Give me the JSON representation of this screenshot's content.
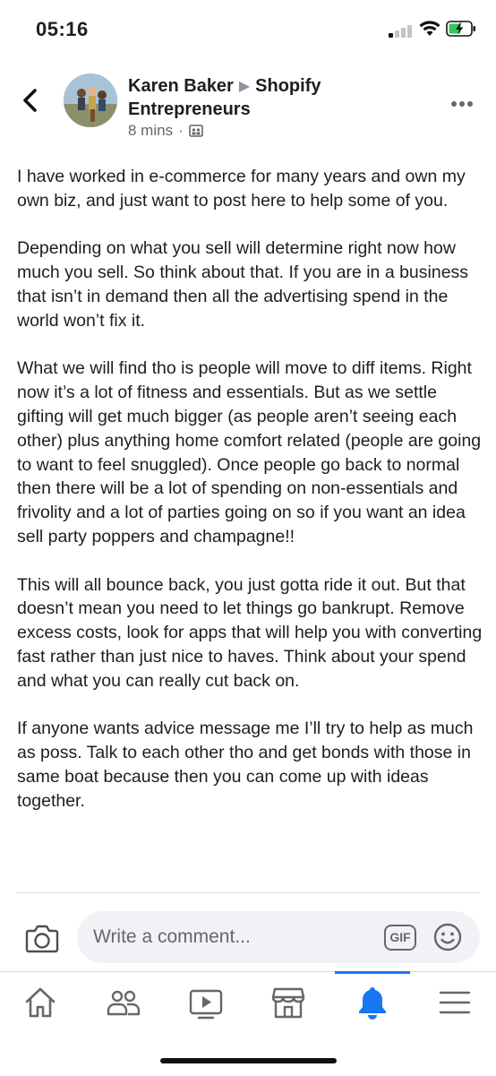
{
  "status_bar": {
    "time": "05:16"
  },
  "post": {
    "author": "Karen Baker",
    "group": "Shopify Entrepreneurs",
    "time_ago": "8 mins",
    "paragraphs": [
      "I have worked in e-commerce for many years and own my own biz, and just want to post here to help some of you.",
      "Depending on what you sell will determine right now how much you sell. So think about that. If you are in a business that isn’t in demand then all the advertising spend in the world won’t fix it.",
      "What we will find tho is people will move to diff items. Right now it’s a lot of fitness and essentials. But as we settle gifting will get much bigger (as people aren’t seeing each other) plus anything home comfort related (people are going to want to feel snuggled). Once people go back to normal then there will be a lot of spending on non-essentials and frivolity and a lot of parties going on so if you want an idea sell party poppers and champagne!!",
      "This will all bounce back, you just gotta ride it out. But that doesn’t mean you need to let things go bankrupt. Remove excess costs, look for apps that will help you with converting fast rather than just nice to haves. Think about your spend and what you can really cut back on.",
      "If anyone wants advice message me I’ll try to help as much as poss. Talk to each other tho and get bonds with those in same boat because then you can come up with ideas together."
    ]
  },
  "comment": {
    "placeholder": "Write a comment...",
    "gif_label": "GIF"
  },
  "tabs": [
    {
      "icon": "home-icon"
    },
    {
      "icon": "groups-icon"
    },
    {
      "icon": "watch-icon"
    },
    {
      "icon": "marketplace-icon"
    },
    {
      "icon": "notifications-bell-icon",
      "active": true
    },
    {
      "icon": "menu-icon"
    }
  ],
  "colors": {
    "accent": "#1877f2",
    "text": "#1c1e21",
    "secondary": "#65676b",
    "input_bg": "#f0f2f5"
  }
}
